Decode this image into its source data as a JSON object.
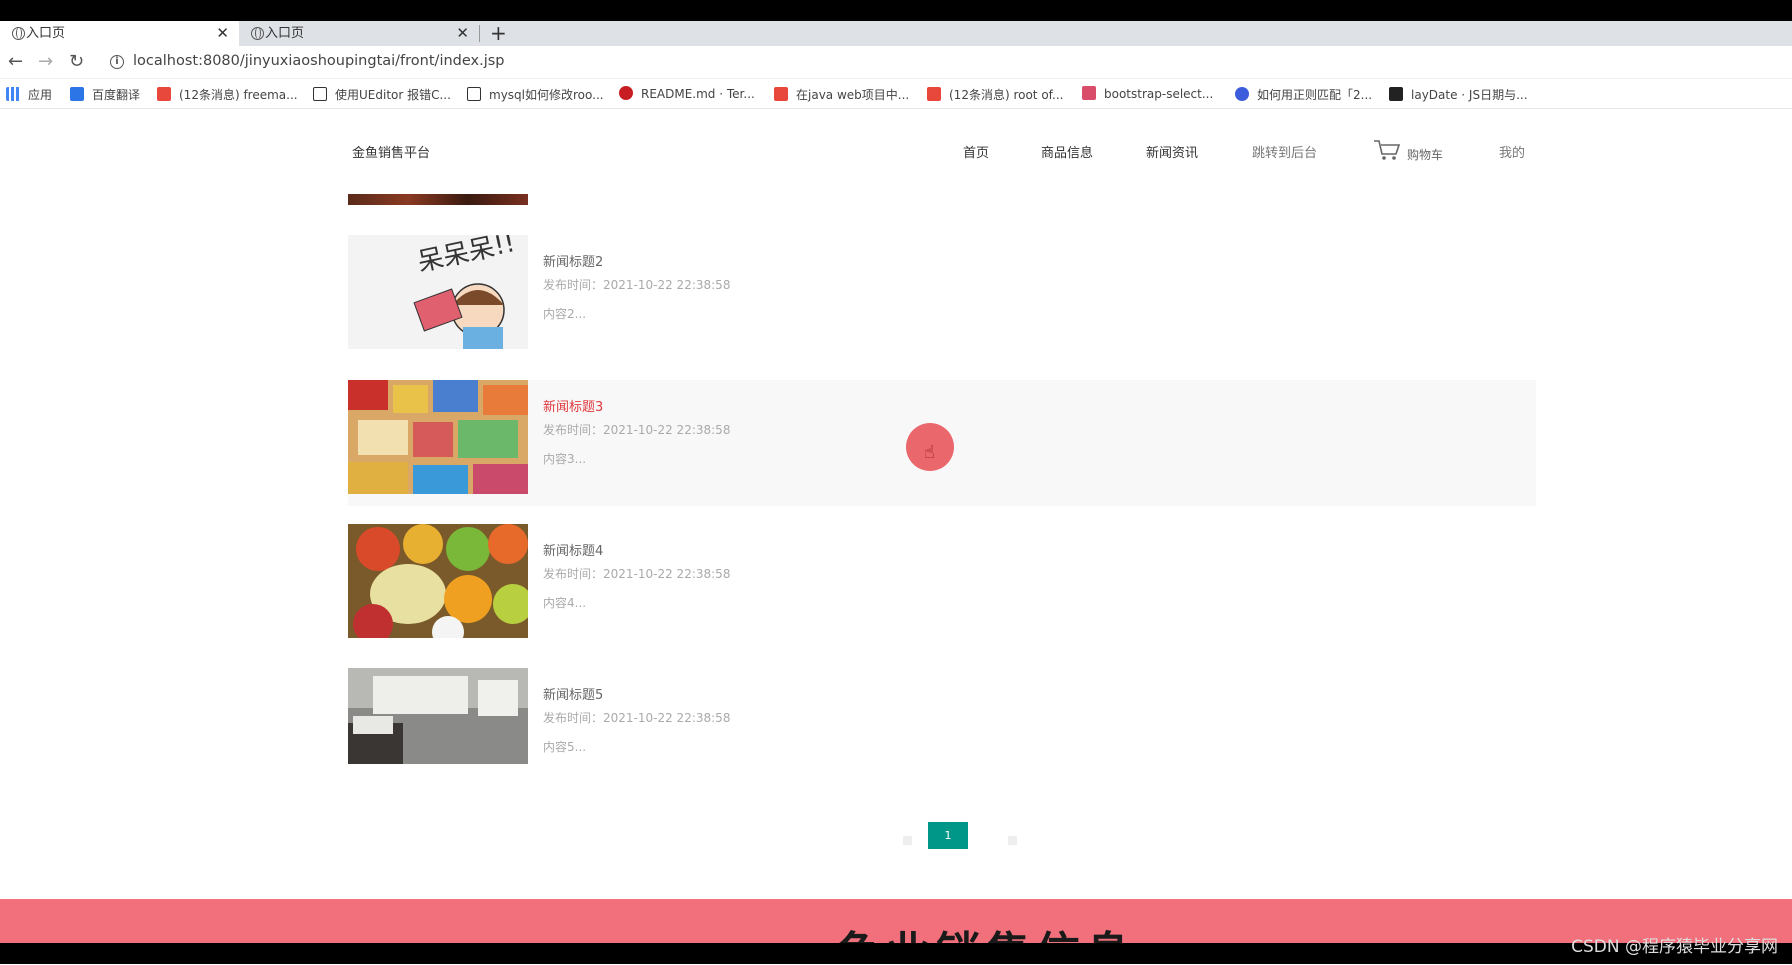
{
  "browser": {
    "tabs": [
      {
        "label": "入口页",
        "active": true
      },
      {
        "label": "入口页",
        "active": false
      }
    ],
    "new_tab": "+",
    "url": "localhost:8080/jinyuxiaoshoupingtai/front/index.jsp",
    "bookmarks": [
      {
        "label": "应用",
        "icon": "apps-icon"
      },
      {
        "label": "百度翻译",
        "icon": "translate-icon"
      },
      {
        "label": "(12条消息) freema...",
        "icon": "csdn-icon"
      },
      {
        "label": "使用UEditor 报错C...",
        "icon": "link-icon"
      },
      {
        "label": "mysql如何修改roo...",
        "icon": "link-icon"
      },
      {
        "label": "README.md · Ter...",
        "icon": "gitee-icon"
      },
      {
        "label": "在java web项目中...",
        "icon": "csdn-icon"
      },
      {
        "label": "(12条消息) root of...",
        "icon": "csdn-icon"
      },
      {
        "label": "bootstrap-select...",
        "icon": "site-icon"
      },
      {
        "label": "如何用正则匹配「2...",
        "icon": "baidu-icon"
      },
      {
        "label": "layDate · JS日期与...",
        "icon": "layui-icon"
      }
    ]
  },
  "site": {
    "brand": "金鱼销售平台",
    "menu": [
      "首页",
      "商品信息",
      "新闻资讯",
      "跳转到后台",
      "购物车",
      "我的"
    ]
  },
  "news": [
    {
      "title": "新闻标题2",
      "meta": "发布时间：2021-10-22 22:38:58",
      "content": "内容2..."
    },
    {
      "title": "新闻标题3",
      "meta": "发布时间：2021-10-22 22:38:58",
      "content": "内容3..."
    },
    {
      "title": "新闻标题4",
      "meta": "发布时间：2021-10-22 22:38:58",
      "content": "内容4..."
    },
    {
      "title": "新闻标题5",
      "meta": "发布时间：2021-10-22 22:38:58",
      "content": "内容5..."
    }
  ],
  "pager": {
    "current": "1"
  },
  "footer": {
    "title": "鱼业销售信息"
  },
  "watermark": "CSDN @程序猿毕业分享网",
  "colors": {
    "accent": "#009688",
    "active_title": "#e0393e",
    "footer": "#f2707c"
  }
}
